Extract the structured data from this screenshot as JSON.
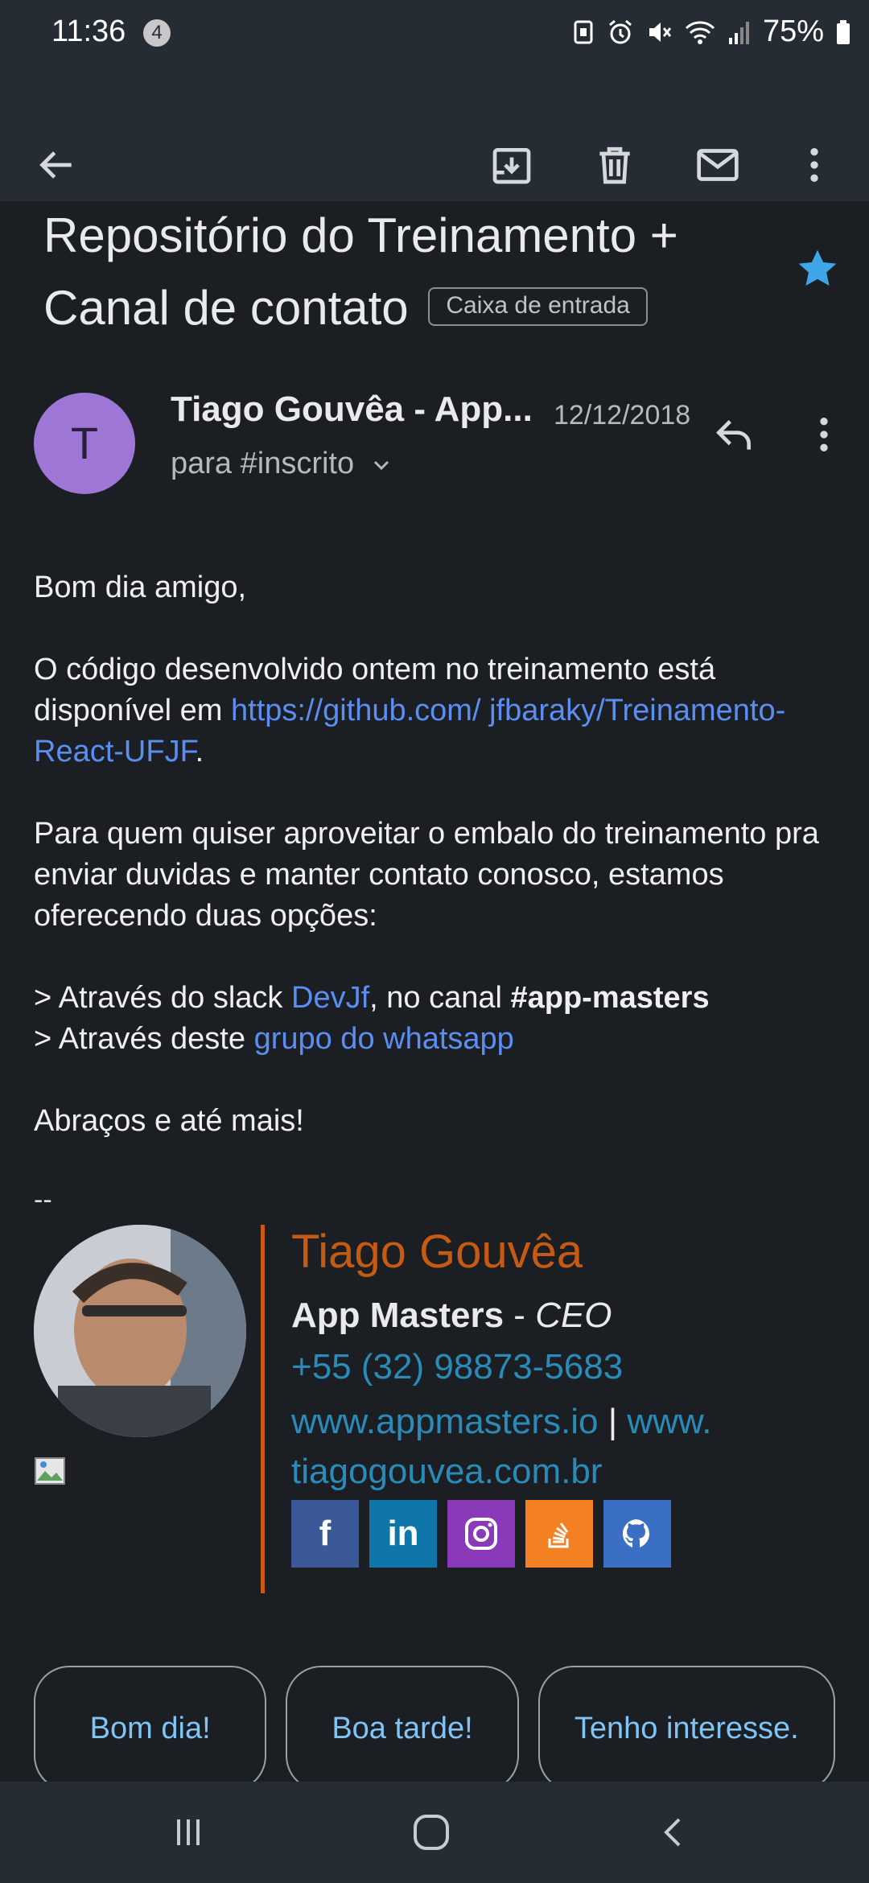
{
  "status_bar": {
    "time": "11:36",
    "notification_count": "4",
    "battery": "75%"
  },
  "toolbar": {
    "back": "back-arrow-icon",
    "archive": "archive-icon",
    "delete": "trash-icon",
    "mark_unread": "mail-icon",
    "more": "more-vert-icon"
  },
  "email": {
    "subject": "Repositório do Treinamento + Canal de contato",
    "label": "Caixa de entrada",
    "starred": true,
    "star_color": "#3ea6e6",
    "sender_initial": "T",
    "sender_name": "Tiago Gouvêa - App...",
    "date": "12/12/2018",
    "recipient": "para #inscrito",
    "body": {
      "greeting": "Bom dia amigo,",
      "p1_text": "O código desenvolvido ontem no treinamento está disponível em ",
      "p1_link": "https://github.com/ jfbaraky/Treinamento-React-UFJF",
      "p1_end": ".",
      "p2": "Para quem quiser aproveitar o embalo do treinamento pra enviar duvidas e manter contato conosco, estamos oferecendo duas opções:",
      "opt1_prefix": "> Através do slack ",
      "opt1_link": "DevJf",
      "opt1_mid": ", no canal ",
      "opt1_channel": "#app-masters",
      "opt2_prefix": "> Através deste ",
      "opt2_link": "grupo do whatsapp",
      "closing": "Abraços e até mais!"
    },
    "signature": {
      "dash": "--",
      "name": "Tiago Gouvêa",
      "company": "App Masters",
      "role_sep": " - ",
      "role": "CEO",
      "phone": "+55 (32) 98873-5683",
      "site1": "www.appmasters.io",
      "sep": " | ",
      "site2": "www. tiagogouvea.com.br",
      "accent_color": "#c75a12",
      "social": [
        {
          "icon": "facebook-icon",
          "glyph": "f",
          "color": "#3b5998"
        },
        {
          "icon": "linkedin-icon",
          "glyph": "in",
          "color": "#0e76a8"
        },
        {
          "icon": "instagram-icon",
          "glyph": "",
          "color": "#8a3ab9"
        },
        {
          "icon": "stackoverflow-icon",
          "glyph": "",
          "color": "#f48024"
        },
        {
          "icon": "github-icon",
          "glyph": "",
          "color": "#3a6fc4"
        }
      ]
    }
  },
  "smart_replies": [
    "Bom dia!",
    "Boa tarde!",
    "Tenho interesse."
  ]
}
